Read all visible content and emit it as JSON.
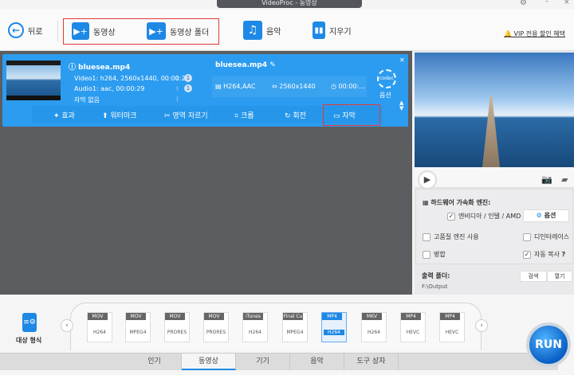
{
  "window": {
    "title": "VideoProc - 동영상"
  },
  "toolbar": {
    "back": "뒤로",
    "video": "동영상",
    "video_folder": "동영상 폴더",
    "music": "음악",
    "clear": "지우기",
    "vip": "VIP 전용 할인 혜택"
  },
  "file": {
    "name": "bluesea.mp4",
    "output_name": "bluesea.mp4",
    "video_info": "Video1: h264, 2560x1440, 00:00:29",
    "audio_info": "Audio1: aac, 00:00:29",
    "subtitle_info": "자막 없음",
    "video_track": "1",
    "audio_track": "1",
    "codec": "H264,AAC",
    "resolution": "2560x1440",
    "duration": "00:00:...",
    "codec_icon_label": "codec",
    "option_label": "옵션"
  },
  "actions": [
    "효과",
    "워터마크",
    "영역 자르기",
    "크롭",
    "회전",
    "자막"
  ],
  "settings": {
    "hw_title": "하드웨어 가속화 엔진:",
    "hw_option": "엔비디아 / 인텔 / AMD",
    "hw_checked": true,
    "option_btn": "옵션",
    "high_quality": "고품질 엔진 사용",
    "high_quality_checked": false,
    "deinterlace": "디인터레이스",
    "deinterlace_checked": false,
    "merge": "병합",
    "merge_checked": false,
    "autocopy": "자동 복사",
    "autocopy_checked": true,
    "help": "?",
    "output_label": "출력 폴더:",
    "output_path": "F:\\Output",
    "browse": "검색",
    "open": "열기"
  },
  "target": {
    "label": "대상 형식",
    "formats": [
      {
        "top": "MOV",
        "bottom": "H264"
      },
      {
        "top": "MOV",
        "bottom": "MPEG4"
      },
      {
        "top": "MOV",
        "bottom": "PRORES"
      },
      {
        "top": "MOV",
        "bottom": "PRORES"
      },
      {
        "top": "iTunes",
        "bottom": "H264"
      },
      {
        "top": "Final Cu",
        "bottom": "MPEG4"
      },
      {
        "top": "MP4",
        "bottom": "H264",
        "selected": true
      },
      {
        "top": "MKV",
        "bottom": "H264"
      },
      {
        "top": "MP4",
        "bottom": "HEVC"
      },
      {
        "top": "MP4",
        "bottom": "HEVC"
      }
    ]
  },
  "tabs": [
    {
      "label": "인기"
    },
    {
      "label": "동영상",
      "selected": true
    },
    {
      "label": "기기"
    },
    {
      "label": "음악"
    },
    {
      "label": "도구 상자"
    }
  ],
  "run": "RUN",
  "colors": {
    "accent": "#1e88e5",
    "highlight": "#e53935"
  }
}
